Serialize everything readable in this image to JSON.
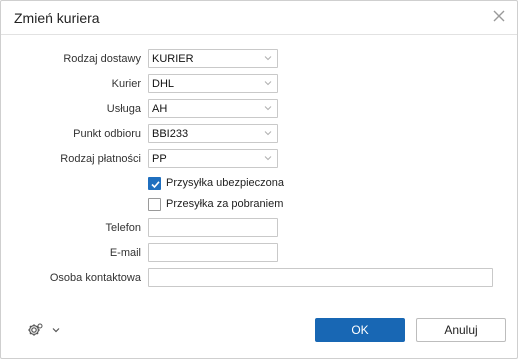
{
  "dialog": {
    "title": "Zmień kuriera"
  },
  "form": {
    "delivery_type": {
      "label": "Rodzaj dostawy",
      "value": "KURIER"
    },
    "courier": {
      "label": "Kurier",
      "value": "DHL"
    },
    "service": {
      "label": "Usługa",
      "value": "AH"
    },
    "pickup_point": {
      "label": "Punkt odbioru",
      "value": "BBI233"
    },
    "payment_type": {
      "label": "Rodzaj płatności",
      "value": "PP"
    },
    "insured": {
      "label": "Przysyłka ubezpieczona",
      "checked": true
    },
    "cod": {
      "label": "Przesyłka za pobraniem",
      "checked": false
    },
    "phone": {
      "label": "Telefon",
      "value": ""
    },
    "email": {
      "label": "E-mail",
      "value": ""
    },
    "contact_person": {
      "label": "Osoba kontaktowa",
      "value": ""
    }
  },
  "footer": {
    "ok_label": "OK",
    "cancel_label": "Anuluj"
  },
  "icons": {
    "close": "close-icon",
    "chevron": "chevron-down-icon",
    "settings": "gear-icon",
    "check": "check-icon"
  },
  "colors": {
    "primary": "#1867b4",
    "checkbox_checked": "#1f6fbf"
  }
}
